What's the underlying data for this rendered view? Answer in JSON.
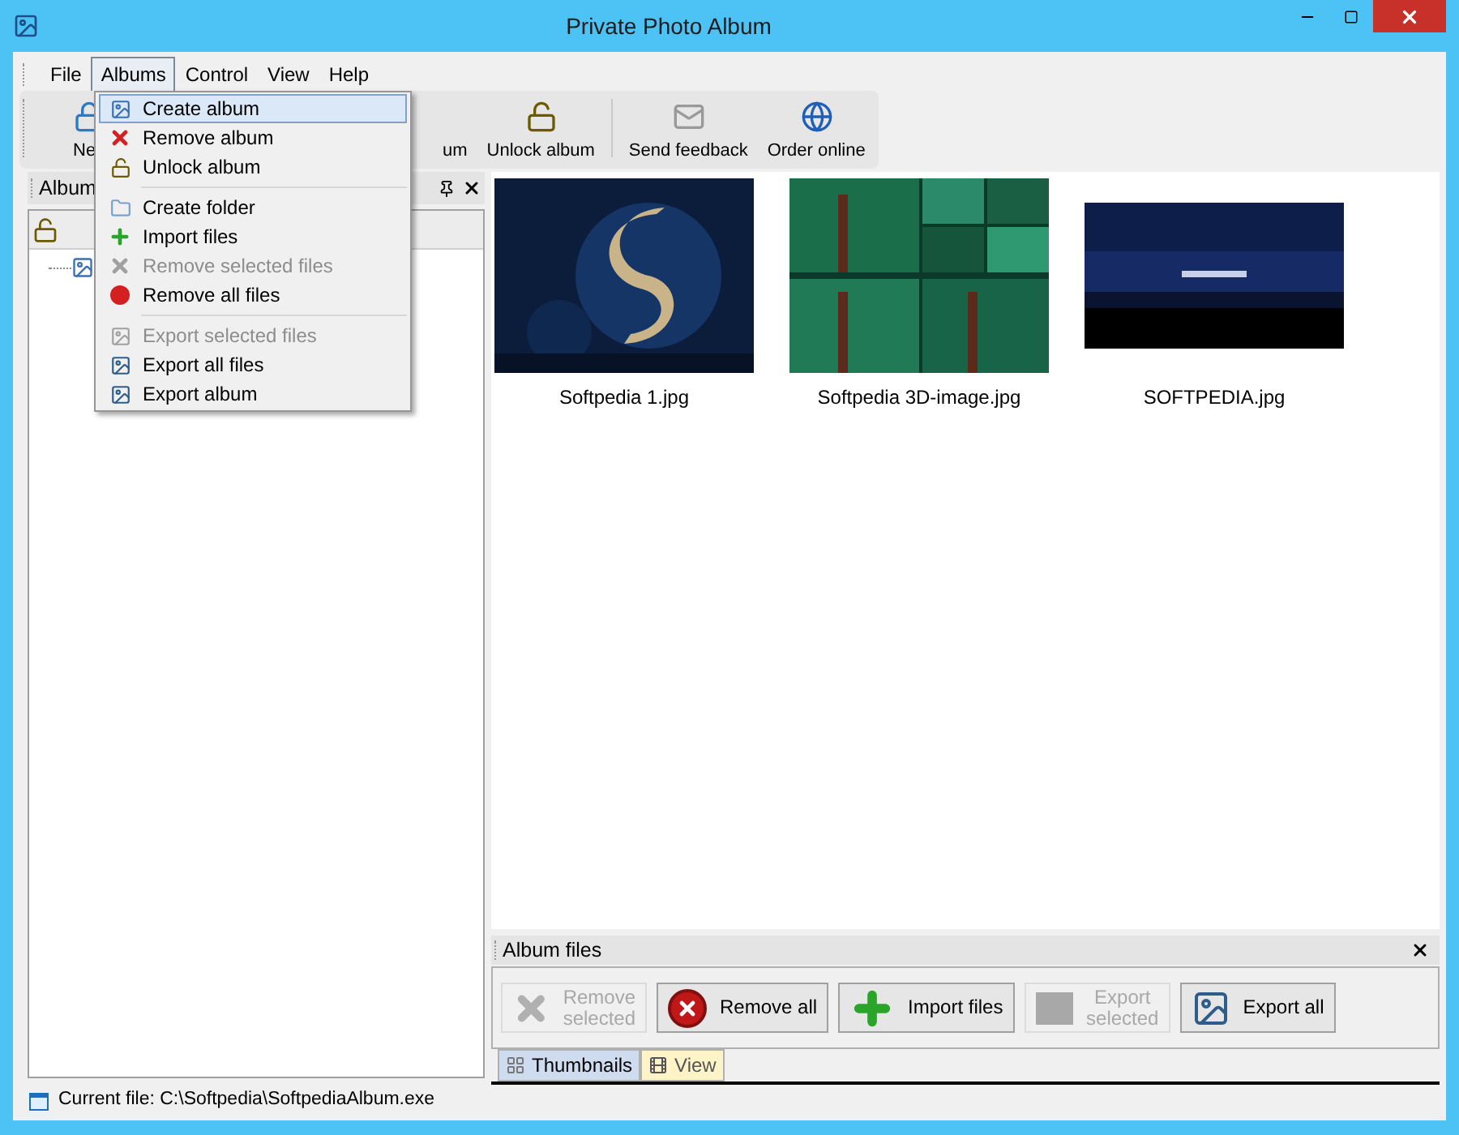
{
  "window": {
    "title": "Private Photo Album"
  },
  "menu_bar": [
    {
      "label": "File",
      "selected": false
    },
    {
      "label": "Albums",
      "selected": true
    },
    {
      "label": "Control",
      "selected": false
    },
    {
      "label": "View",
      "selected": false
    },
    {
      "label": "Help",
      "selected": false
    }
  ],
  "albums_menu": [
    [
      {
        "label": "Create album",
        "kind": "create",
        "disabled": false,
        "selected": true
      },
      {
        "label": "Remove album",
        "kind": "remove",
        "disabled": false,
        "selected": false
      },
      {
        "label": "Unlock album",
        "kind": "unlock",
        "disabled": false,
        "selected": false
      }
    ],
    [
      {
        "label": "Create folder",
        "kind": "folder",
        "disabled": false,
        "selected": false
      },
      {
        "label": "Import files",
        "kind": "import",
        "disabled": false,
        "selected": false
      },
      {
        "label": "Remove selected files",
        "kind": "remove_selected",
        "disabled": true,
        "selected": false
      },
      {
        "label": "Remove all files",
        "kind": "remove_all",
        "disabled": false,
        "selected": false
      }
    ],
    [
      {
        "label": "Export selected files",
        "kind": "export",
        "disabled": true,
        "selected": false
      },
      {
        "label": "Export all files",
        "kind": "export",
        "disabled": false,
        "selected": false
      },
      {
        "label": "Export album",
        "kind": "export",
        "disabled": false,
        "selected": false
      }
    ]
  ],
  "toolbar": [
    {
      "label": "Ne",
      "kind": "new"
    },
    {
      "label": "um",
      "kind": "hidden"
    },
    {
      "label": "Unlock album",
      "kind": "unlock"
    },
    {
      "label": "Send feedback",
      "kind": "feedback"
    },
    {
      "label": "Order online",
      "kind": "globe"
    }
  ],
  "albums_panel": {
    "title": "Album"
  },
  "thumbnails": [
    {
      "caption": "Softpedia 1.jpg",
      "kind": "swirl"
    },
    {
      "caption": "Softpedia 3D-image.jpg",
      "kind": "forest"
    },
    {
      "caption": "SOFTPEDIA.jpg",
      "kind": "banner"
    }
  ],
  "album_files": {
    "title": "Album files",
    "buttons": [
      {
        "label": "Remove selected",
        "kind": "remove_selected",
        "disabled": true
      },
      {
        "label": "Remove all",
        "kind": "remove_all",
        "disabled": false
      },
      {
        "label": "Import files",
        "kind": "import",
        "disabled": false
      },
      {
        "label": "Export selected",
        "kind": "export_selected",
        "disabled": true
      },
      {
        "label": "Export all",
        "kind": "export_all",
        "disabled": false
      }
    ],
    "tabs": [
      {
        "label": "Thumbnails",
        "selected": true
      },
      {
        "label": "View",
        "selected": false
      }
    ]
  },
  "status_bar": {
    "text": "Current file: C:\\Softpedia\\SoftpediaAlbum.exe"
  }
}
